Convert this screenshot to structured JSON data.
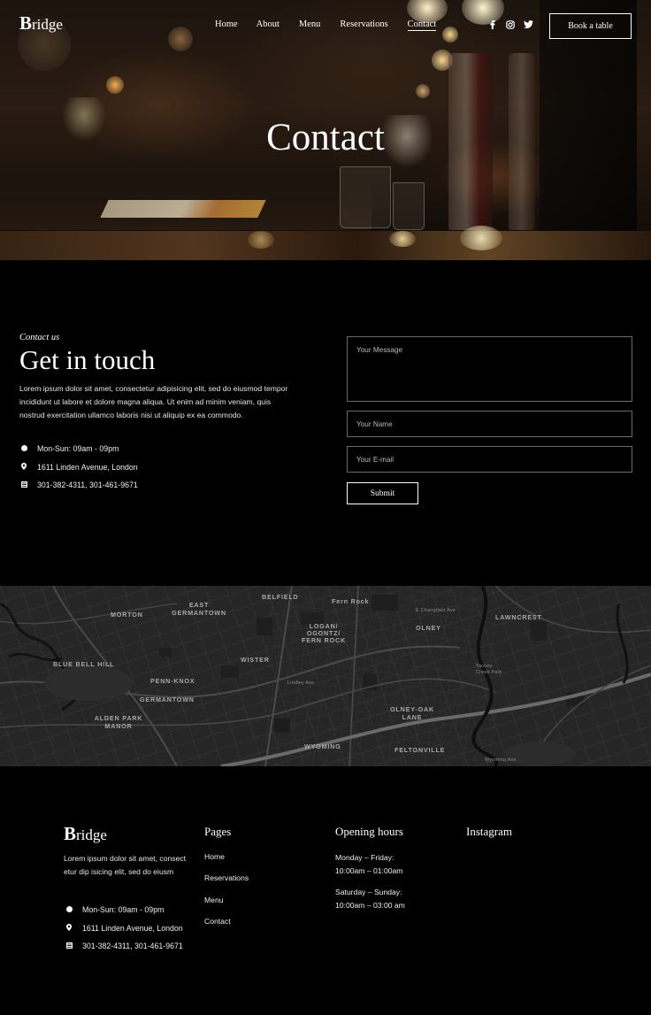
{
  "brand": {
    "first_letter": "B",
    "rest": "ridge"
  },
  "nav": {
    "items": [
      {
        "label": "Home"
      },
      {
        "label": "About"
      },
      {
        "label": "Menu"
      },
      {
        "label": "Reservations"
      },
      {
        "label": "Contact",
        "active": true
      }
    ],
    "social_icons": [
      "facebook-icon",
      "instagram-icon",
      "twitter-icon"
    ],
    "book_label": "Book a table"
  },
  "hero": {
    "title": "Contact"
  },
  "contact": {
    "eyebrow": "Contact us",
    "heading": "Get in touch",
    "description": "Lorem ipsum dolor sit amet, consectetur adipisicing elit, sed do eiusmod tempor incididunt ut labore et dolore magna aliqua. Ut enim ad minim veniam, quis nostrud exercitation ullamco laboris nisi ut aliquip ex ea commodo.",
    "info": [
      {
        "icon": "clock-icon",
        "text": "Mon-Sun: 09am - 09pm"
      },
      {
        "icon": "location-pin-icon",
        "text": "1611 Linden Avenue, London"
      },
      {
        "icon": "phone-icon",
        "text": "301-382-4311, 301-461-9671"
      }
    ]
  },
  "form": {
    "message_placeholder": "Your Message",
    "name_placeholder": "Your Name",
    "email_placeholder": "Your E-mail",
    "submit_label": "Submit"
  },
  "map": {
    "labels": [
      "Morton",
      "East Germantown",
      "Belfield",
      "Fern Rock",
      "Lawncrest",
      "Logan/ Ogontz/ Fern Rock",
      "Olney",
      "Blue Bell Hill",
      "Wister",
      "Penn-Knox",
      "Germantown",
      "Alden Park Manor",
      "Olney-Oak Lane",
      "Wyoming",
      "Feltonville"
    ],
    "street_labels": [
      "Tacony Creek Park",
      "W Champlain Ave",
      "E Champlain Ave",
      "Lindley Ave",
      "W Hunting Park Ave",
      "Roosevelt Blvd",
      "Wyoming Ave"
    ]
  },
  "footer": {
    "description": "Lorem ipsum dolor sit amet, consect etur dip isicing elit, sed do eiusm",
    "info": [
      {
        "icon": "clock-icon",
        "text": "Mon-Sun: 09am - 09pm"
      },
      {
        "icon": "location-pin-icon",
        "text": "1611 Linden Avenue, London"
      },
      {
        "icon": "phone-icon",
        "text": "301-382-4311, 301-461-9671"
      }
    ],
    "pages_title": "Pages",
    "pages": [
      {
        "label": "Home"
      },
      {
        "label": "Reservations"
      },
      {
        "label": "Menu"
      },
      {
        "label": "Contact"
      }
    ],
    "hours_title": "Opening hours",
    "hours": [
      {
        "days": "Monday – Friday:",
        "time": "10:00am – 01:00am"
      },
      {
        "days": "Saturday – Sunday:",
        "time": "10:00am – 03:00 am"
      }
    ],
    "instagram_title": "Instagram"
  }
}
